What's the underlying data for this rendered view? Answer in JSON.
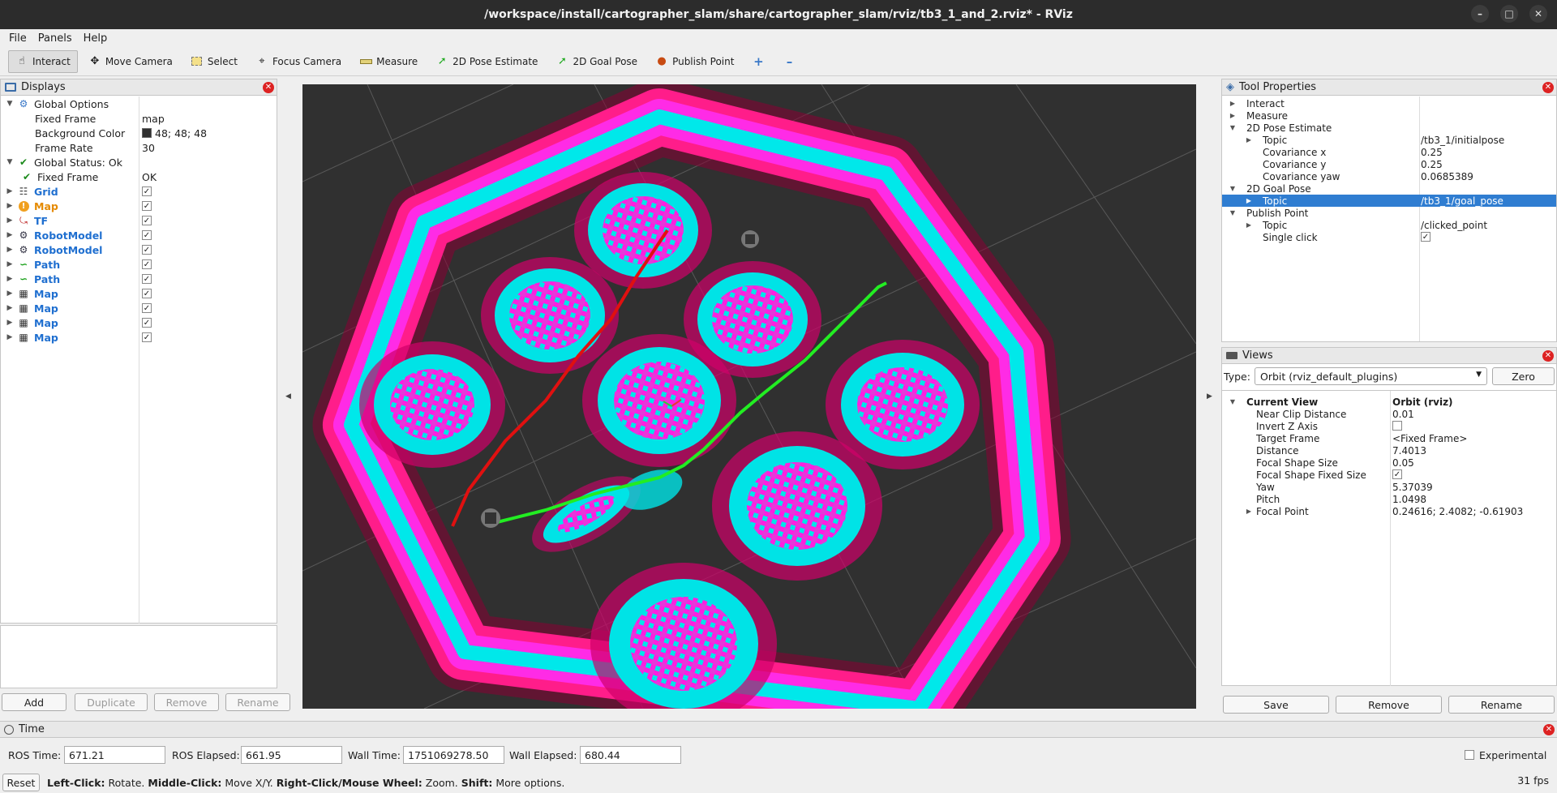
{
  "window": {
    "title": "/workspace/install/cartographer_slam/share/cartographer_slam/rviz/tb3_1_and_2.rviz* - RViz"
  },
  "menu": [
    "File",
    "Panels",
    "Help"
  ],
  "toolbar": {
    "interact": "Interact",
    "move_camera": "Move Camera",
    "select": "Select",
    "focus_camera": "Focus Camera",
    "measure": "Measure",
    "pose_estimate": "2D Pose Estimate",
    "goal_pose": "2D Goal Pose",
    "publish_point": "Publish Point"
  },
  "displays": {
    "title": "Displays",
    "global_options": "Global Options",
    "fixed_frame_label": "Fixed Frame",
    "fixed_frame_value": "map",
    "bg_color_label": "Background Color",
    "bg_color_value": "48; 48; 48",
    "frame_rate_label": "Frame Rate",
    "frame_rate_value": "30",
    "global_status": "Global Status: Ok",
    "status_fixed_frame": "Fixed Frame",
    "status_fixed_frame_value": "OK",
    "items": [
      {
        "label": "Grid",
        "icon": "grid-icon",
        "color": "#1f6fd0"
      },
      {
        "label": "Map",
        "icon": "map-warning-icon",
        "color": "#e58a00"
      },
      {
        "label": "TF",
        "icon": "tf-icon",
        "color": "#1f6fd0"
      },
      {
        "label": "RobotModel",
        "icon": "robot-icon",
        "color": "#1f6fd0"
      },
      {
        "label": "RobotModel",
        "icon": "robot-icon",
        "color": "#1f6fd0"
      },
      {
        "label": "Path",
        "icon": "path-icon",
        "color": "#1f6fd0"
      },
      {
        "label": "Path",
        "icon": "path-icon",
        "color": "#1f6fd0"
      },
      {
        "label": "Map",
        "icon": "map-icon",
        "color": "#1f6fd0"
      },
      {
        "label": "Map",
        "icon": "map-icon",
        "color": "#1f6fd0"
      },
      {
        "label": "Map",
        "icon": "map-icon",
        "color": "#1f6fd0"
      },
      {
        "label": "Map",
        "icon": "map-icon",
        "color": "#1f6fd0"
      }
    ],
    "buttons": {
      "add": "Add",
      "duplicate": "Duplicate",
      "remove": "Remove",
      "rename": "Rename"
    }
  },
  "tool_properties": {
    "title": "Tool Properties",
    "interact": "Interact",
    "measure": "Measure",
    "pose_estimate": "2D Pose Estimate",
    "topic_label": "Topic",
    "pose_topic": "/tb3_1/initialpose",
    "cov_x_label": "Covariance x",
    "cov_x": "0.25",
    "cov_y_label": "Covariance y",
    "cov_y": "0.25",
    "cov_yaw_label": "Covariance yaw",
    "cov_yaw": "0.0685389",
    "goal_pose": "2D Goal Pose",
    "goal_topic": "/tb3_1/goal_pose",
    "publish_point": "Publish Point",
    "point_topic": "/clicked_point",
    "single_click_label": "Single click"
  },
  "views": {
    "title": "Views",
    "type_label": "Type:",
    "type_value": "Orbit (rviz_default_plugins)",
    "zero": "Zero",
    "current_view": "Current View",
    "current_view_value": "Orbit (rviz)",
    "near_clip_label": "Near Clip Distance",
    "near_clip": "0.01",
    "invert_z_label": "Invert Z Axis",
    "target_frame_label": "Target Frame",
    "target_frame": "<Fixed Frame>",
    "distance_label": "Distance",
    "distance": "7.4013",
    "focal_size_label": "Focal Shape Size",
    "focal_size": "0.05",
    "focal_fixed_label": "Focal Shape Fixed Size",
    "yaw_label": "Yaw",
    "yaw": "5.37039",
    "pitch_label": "Pitch",
    "pitch": "1.0498",
    "focal_point_label": "Focal Point",
    "focal_point": "0.24616; 2.4082; -0.61903",
    "buttons": {
      "save": "Save",
      "remove": "Remove",
      "rename": "Rename"
    }
  },
  "time": {
    "title": "Time",
    "ros_time_label": "ROS Time:",
    "ros_time": "671.21",
    "ros_elapsed_label": "ROS Elapsed:",
    "ros_elapsed": "661.95",
    "wall_time_label": "Wall Time:",
    "wall_time": "1751069278.50",
    "wall_elapsed_label": "Wall Elapsed:",
    "wall_elapsed": "680.44",
    "experimental": "Experimental"
  },
  "status": {
    "reset": "Reset",
    "left_click": "Left-Click:",
    "left_click_desc": " Rotate. ",
    "middle_click": "Middle-Click:",
    "middle_click_desc": " Move X/Y. ",
    "right_click": "Right-Click/Mouse Wheel:",
    "right_click_desc": " Zoom. ",
    "shift": "Shift:",
    "shift_desc": " More options.",
    "fps": "31 fps"
  }
}
